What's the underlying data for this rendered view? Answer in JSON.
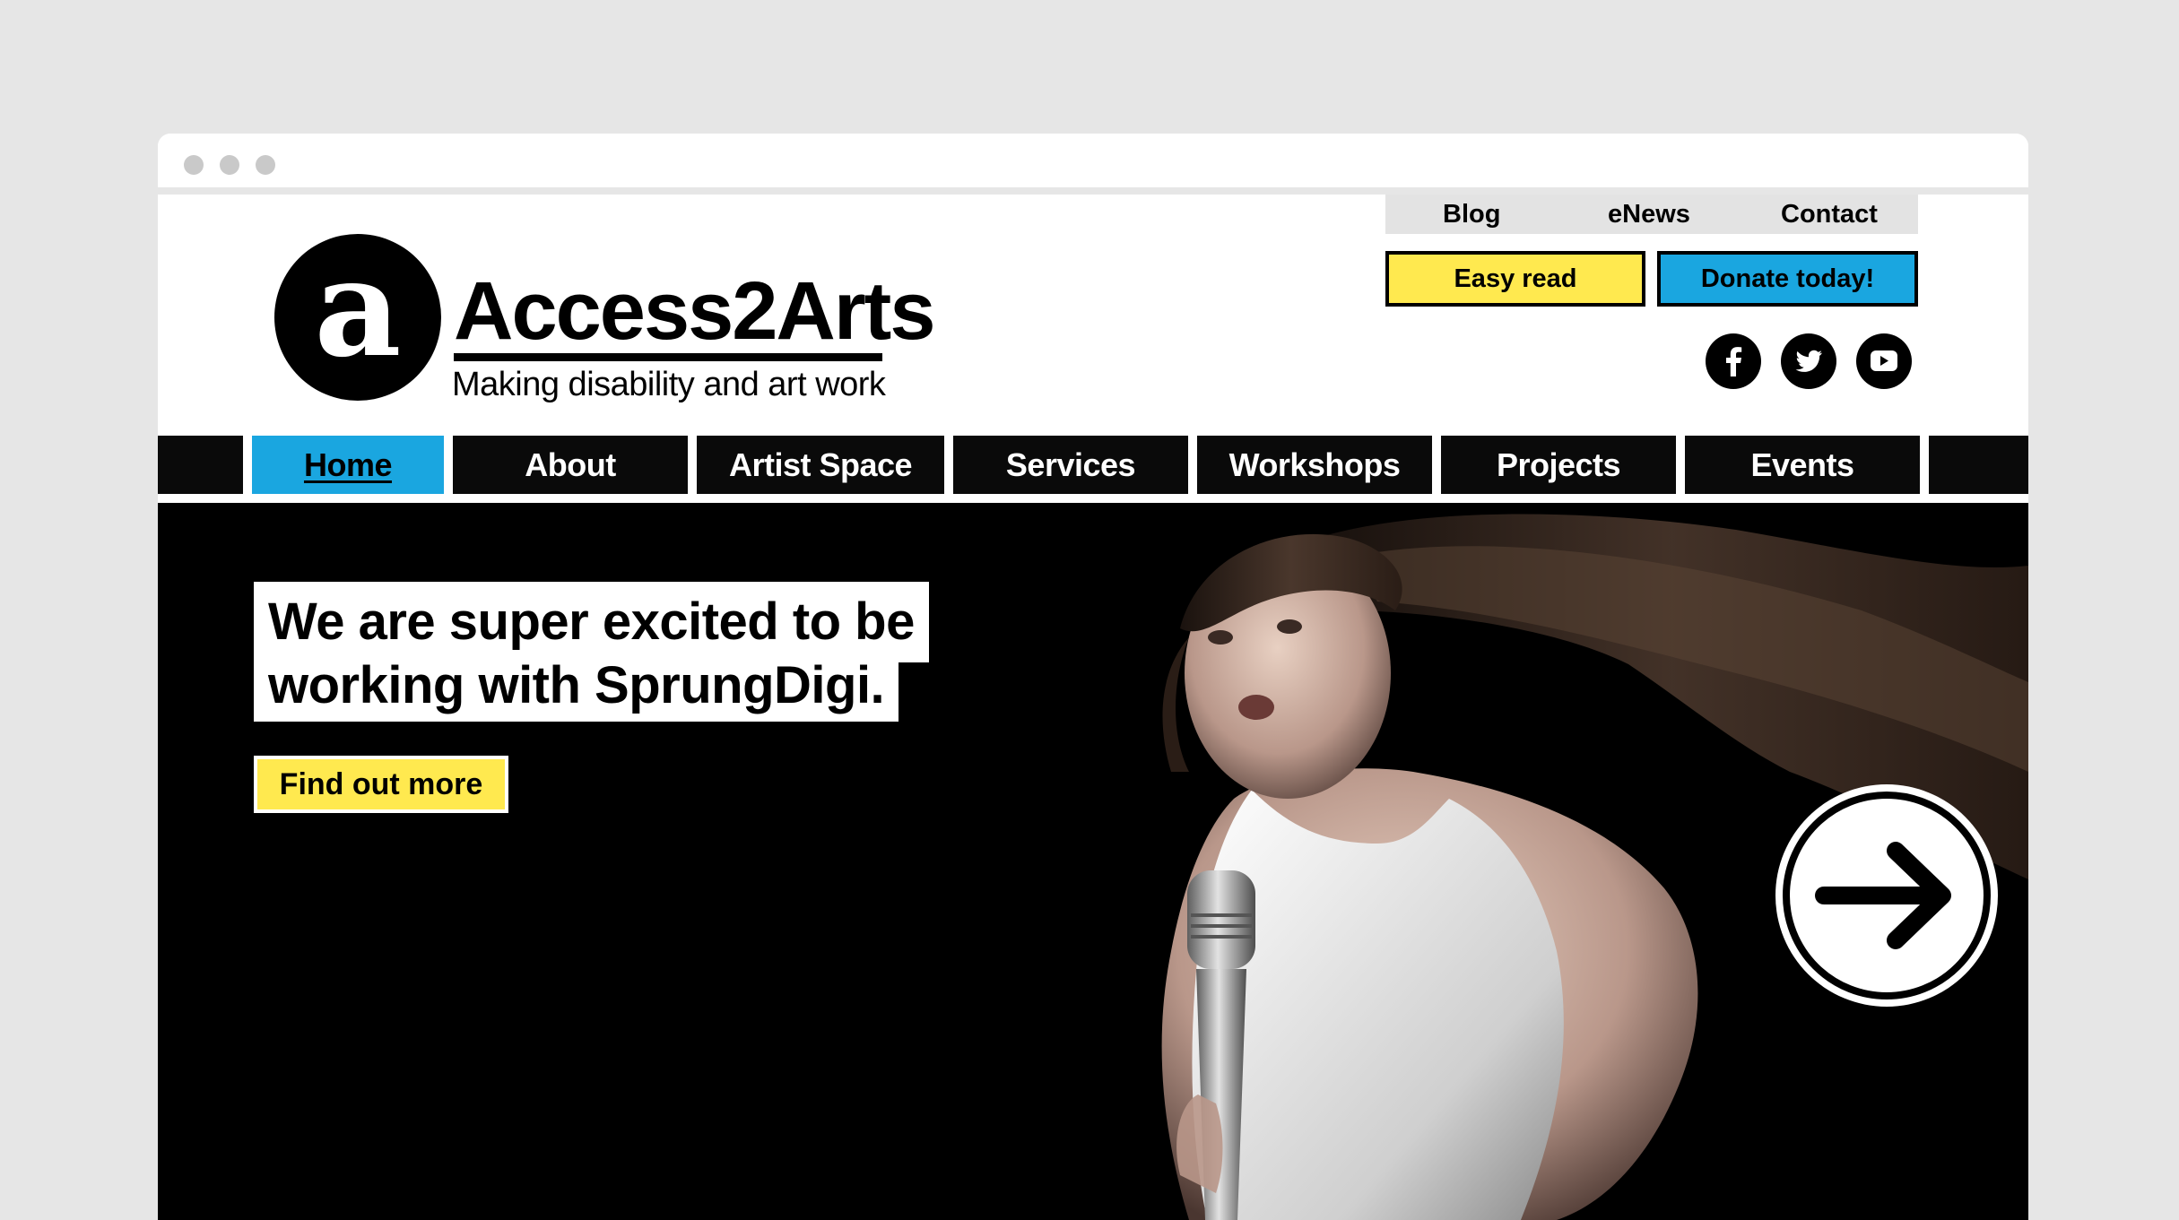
{
  "browser": {
    "dots": [
      "window-dot",
      "window-dot",
      "window-dot"
    ]
  },
  "logo": {
    "mark_letter": "a",
    "name": "Access2Arts",
    "tagline": "Making disability and art work"
  },
  "utility_nav": {
    "items": [
      {
        "label": "Blog"
      },
      {
        "label": "eNews"
      },
      {
        "label": "Contact"
      }
    ]
  },
  "actions": {
    "easy_read_label": "Easy read",
    "donate_label": "Donate today!"
  },
  "social": [
    {
      "icon": "facebook-icon"
    },
    {
      "icon": "twitter-icon"
    },
    {
      "icon": "youtube-icon"
    }
  ],
  "main_nav": {
    "items": [
      {
        "label": "Home",
        "active": true
      },
      {
        "label": "About"
      },
      {
        "label": "Artist Space"
      },
      {
        "label": "Services"
      },
      {
        "label": "Workshops"
      },
      {
        "label": "Projects"
      },
      {
        "label": "Events"
      }
    ]
  },
  "hero": {
    "headline_line1": "We are super excited to be",
    "headline_line2": "working with SprungDigi.",
    "cta_label": "Find out more",
    "next_icon": "arrow-right-icon"
  },
  "colors": {
    "accent_blue": "#1aa6e0",
    "accent_yellow": "#ffe94f",
    "black": "#000000"
  }
}
